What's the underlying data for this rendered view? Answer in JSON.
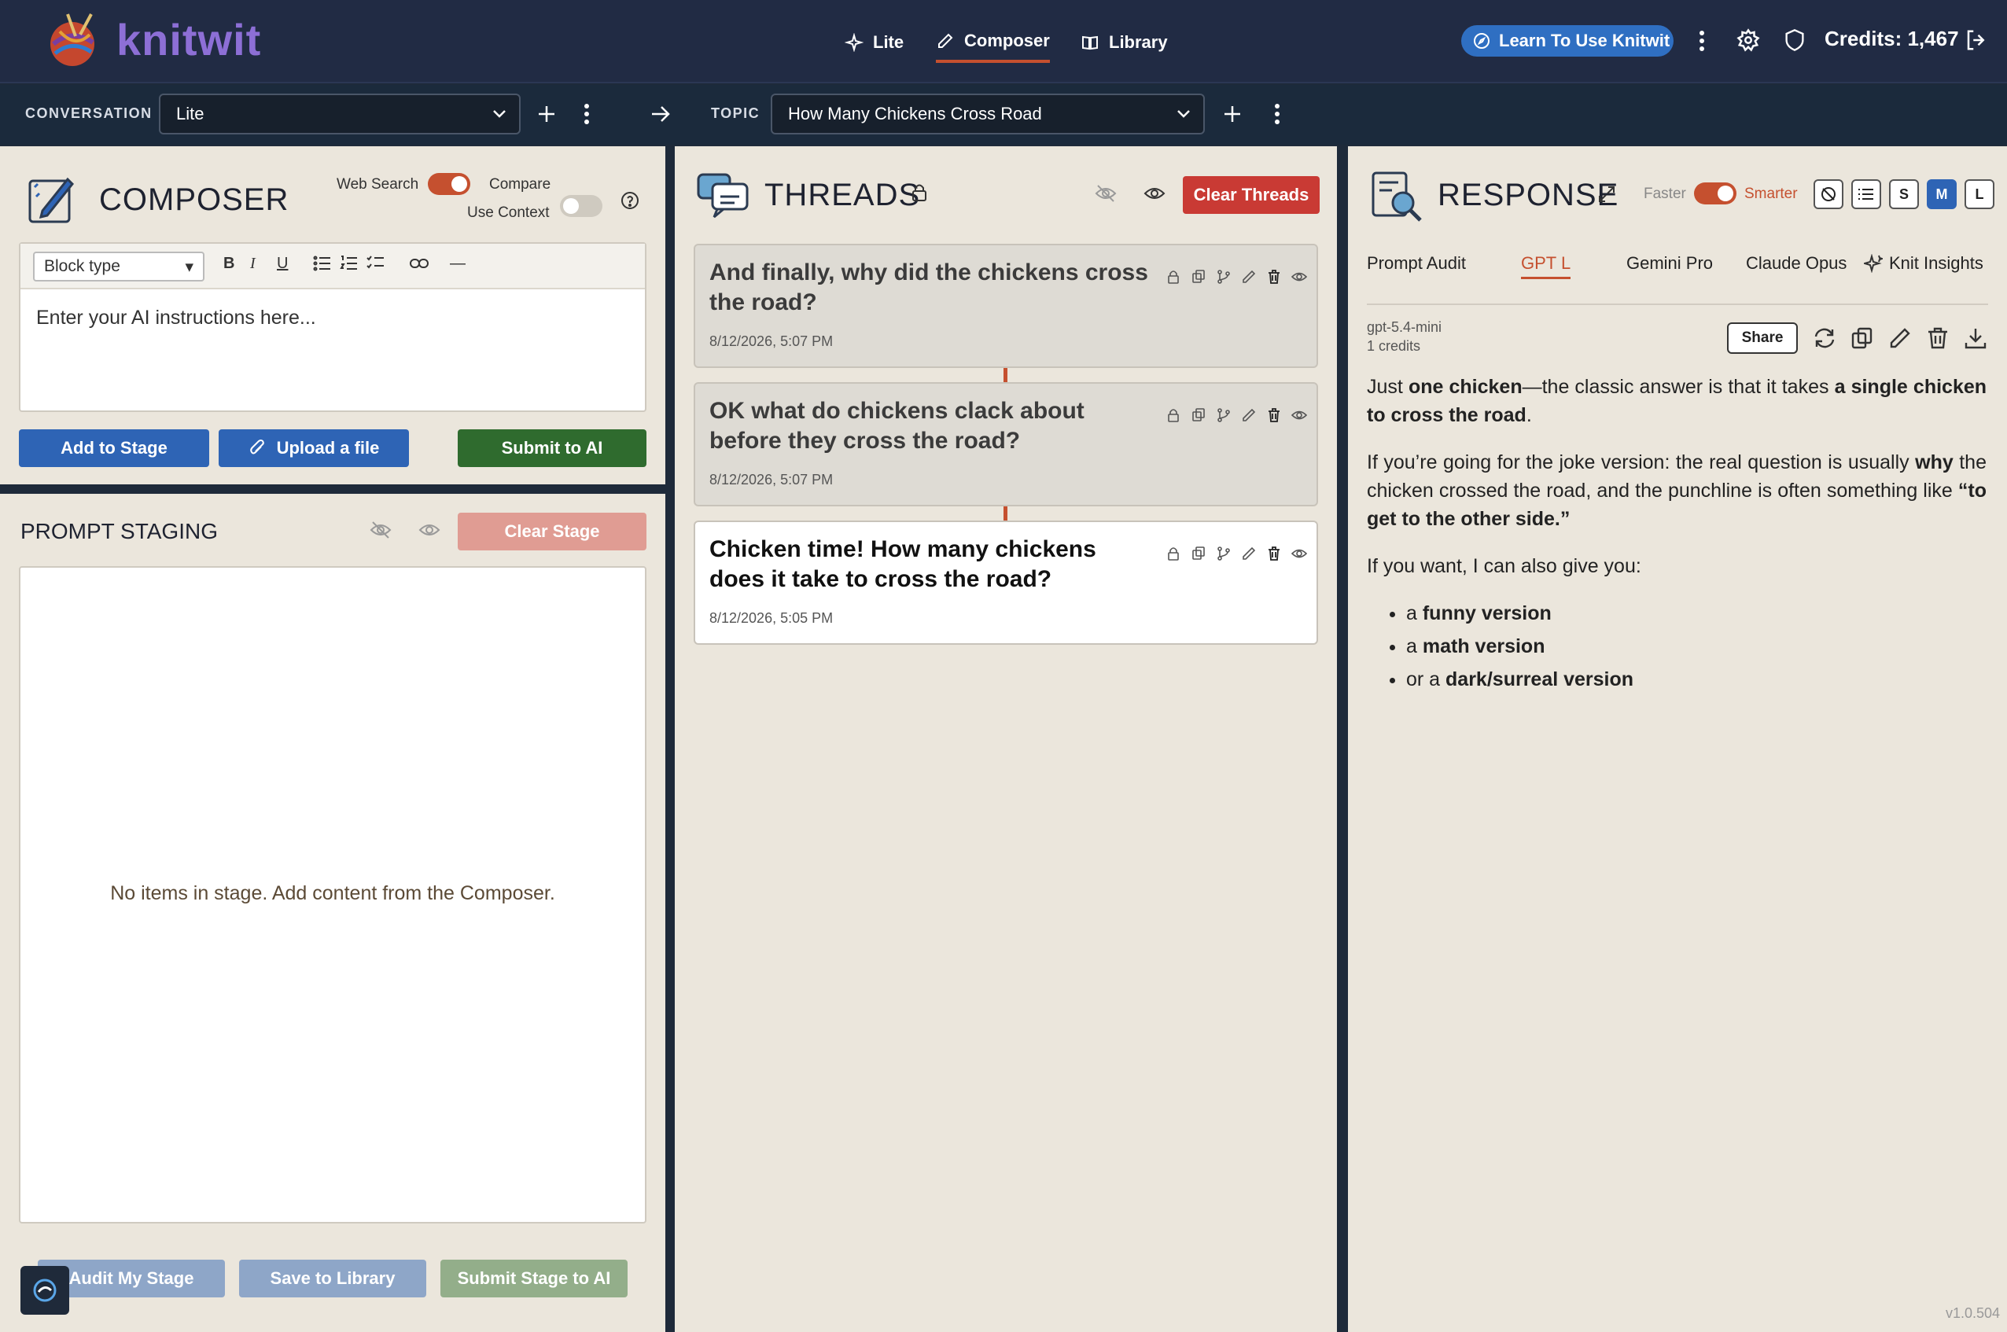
{
  "app": {
    "brand": "knitwit",
    "version": "v1.0.504"
  },
  "nav": {
    "tabs": [
      {
        "label": "Lite",
        "icon": "sparkle-icon"
      },
      {
        "label": "Composer",
        "icon": "pencil-icon",
        "active": true
      },
      {
        "label": "Library",
        "icon": "book-icon"
      }
    ],
    "learn_label": "Learn To Use Knitwit",
    "credits": "Credits: 1,467"
  },
  "conversation": {
    "label": "CONVERSATION",
    "value": "Lite"
  },
  "topic": {
    "label": "TOPIC",
    "value": "How Many Chickens Cross Road"
  },
  "composer": {
    "title": "COMPOSER",
    "web_search_label": "Web Search",
    "compare_label": "Compare",
    "use_context_label": "Use Context",
    "toggles": {
      "web_search": true,
      "compare": false,
      "use_context": true
    },
    "block_type": "Block type",
    "placeholder": "Enter your AI instructions here...",
    "add_to_stage": "Add to Stage",
    "upload": "Upload a file",
    "submit": "Submit to AI"
  },
  "staging": {
    "title": "PROMPT STAGING",
    "clear": "Clear Stage",
    "empty": "No items in stage. Add content from the Composer.",
    "audit": "Audit My Stage",
    "save": "Save to Library",
    "submit": "Submit Stage to AI"
  },
  "threads": {
    "title": "THREADS",
    "clear": "Clear Threads",
    "items": [
      {
        "title": "And finally, why did the chickens cross the road?",
        "date": "8/12/2026, 5:07 PM"
      },
      {
        "title": "OK what do chickens clack about before they cross the road?",
        "date": "8/12/2026, 5:07 PM"
      },
      {
        "title": "Chicken time! How many chickens does it take to cross the road?",
        "date": "8/12/2026, 5:05 PM"
      }
    ]
  },
  "response": {
    "title": "RESPONSE",
    "faster": "Faster",
    "smarter": "Smarter",
    "sizes": [
      "S",
      "M",
      "L"
    ],
    "tabs": [
      "Prompt Audit",
      "GPT L",
      "Gemini Pro",
      "Claude Opus",
      "Knit Insights"
    ],
    "model": "gpt-5.4-mini",
    "credits": "1 credits",
    "share": "Share",
    "p1_a": "Just ",
    "p1_b": "one chicken",
    "p1_c": "—the classic answer is that it takes ",
    "p1_d": "a single chicken to cross the road",
    "p1_e": ".",
    "p2_a": "If you’re going for the joke version: the real question is usually ",
    "p2_b": "why",
    "p2_c": " the chicken crossed the road, and the punchline is often something like ",
    "p2_d": "“to get to the other side.”",
    "p3": "If you want, I can also give you:",
    "bullets": [
      {
        "pre": "a ",
        "bold": "funny version"
      },
      {
        "pre": "a ",
        "bold": "math version"
      },
      {
        "pre": "or a ",
        "bold": "dark/surreal version"
      }
    ]
  }
}
